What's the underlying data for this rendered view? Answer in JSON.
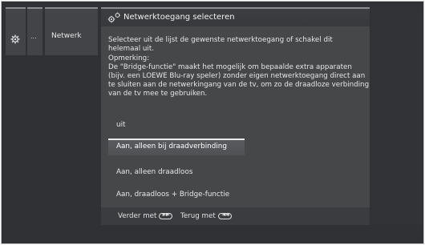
{
  "breadcrumb": {
    "items": [
      {
        "icon": "gear-icon"
      },
      {
        "label": "..."
      },
      {
        "label": "Netwerk"
      }
    ]
  },
  "dialog": {
    "icon": "network-icon",
    "title": "Netwerktoegang selecteren",
    "intro": "Selecteer uit de lijst de gewenste netwerktoegang of schakel dit helemaal uit.",
    "remark_label": "Opmerking:",
    "remark_text": "De \"Bridge-functie\" maakt het mogelijk om bepaalde extra apparaten (bijv. een LOEWE Blu-ray speler) zonder eigen netwerktoegang direct aan te sluiten aan de netwerkingang van de tv, om zo de draadloze verbinding van de tv mee te gebruiken.",
    "options": [
      {
        "label": "uit",
        "selected": false
      },
      {
        "label": "Aan, alleen bij draadverbinding",
        "selected": true
      },
      {
        "label": "Aan, alleen draadloos",
        "selected": false
      },
      {
        "label": "Aan, draadloos + Bridge-functie",
        "selected": false
      }
    ],
    "footer": {
      "forward_label": "Verder met",
      "forward_button": "►►",
      "back_label": "Terug met",
      "back_button": "◄◄"
    }
  },
  "colors": {
    "background": "#303134",
    "dialog": "#464749",
    "selected_option": "#555659",
    "text": "#e6e6e6"
  }
}
